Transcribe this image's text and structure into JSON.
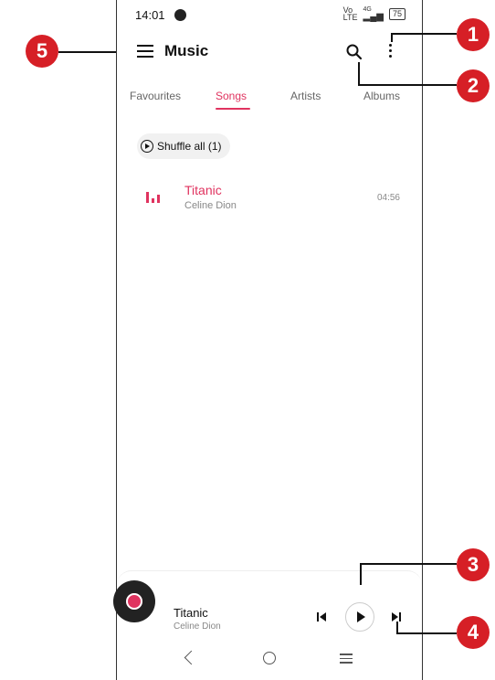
{
  "status": {
    "time": "14:01",
    "net_top": "Vo",
    "net_bottom": "LTE",
    "sig": "4G",
    "battery": "75"
  },
  "appbar": {
    "title": "Music"
  },
  "tabs": [
    {
      "label": "Favourites",
      "active": false
    },
    {
      "label": "Songs",
      "active": true
    },
    {
      "label": "Artists",
      "active": false
    },
    {
      "label": "Albums",
      "active": false
    }
  ],
  "shuffle": {
    "label": "Shuffle all (1)"
  },
  "songs": [
    {
      "title": "Titanic",
      "artist": "Celine Dion",
      "duration": "04:56"
    }
  ],
  "mini_player": {
    "title": "Titanic",
    "artist": "Celine Dion"
  },
  "callouts": [
    "1",
    "2",
    "3",
    "4",
    "5"
  ],
  "colors": {
    "accent": "#e0335f",
    "callout": "#d61f26"
  }
}
